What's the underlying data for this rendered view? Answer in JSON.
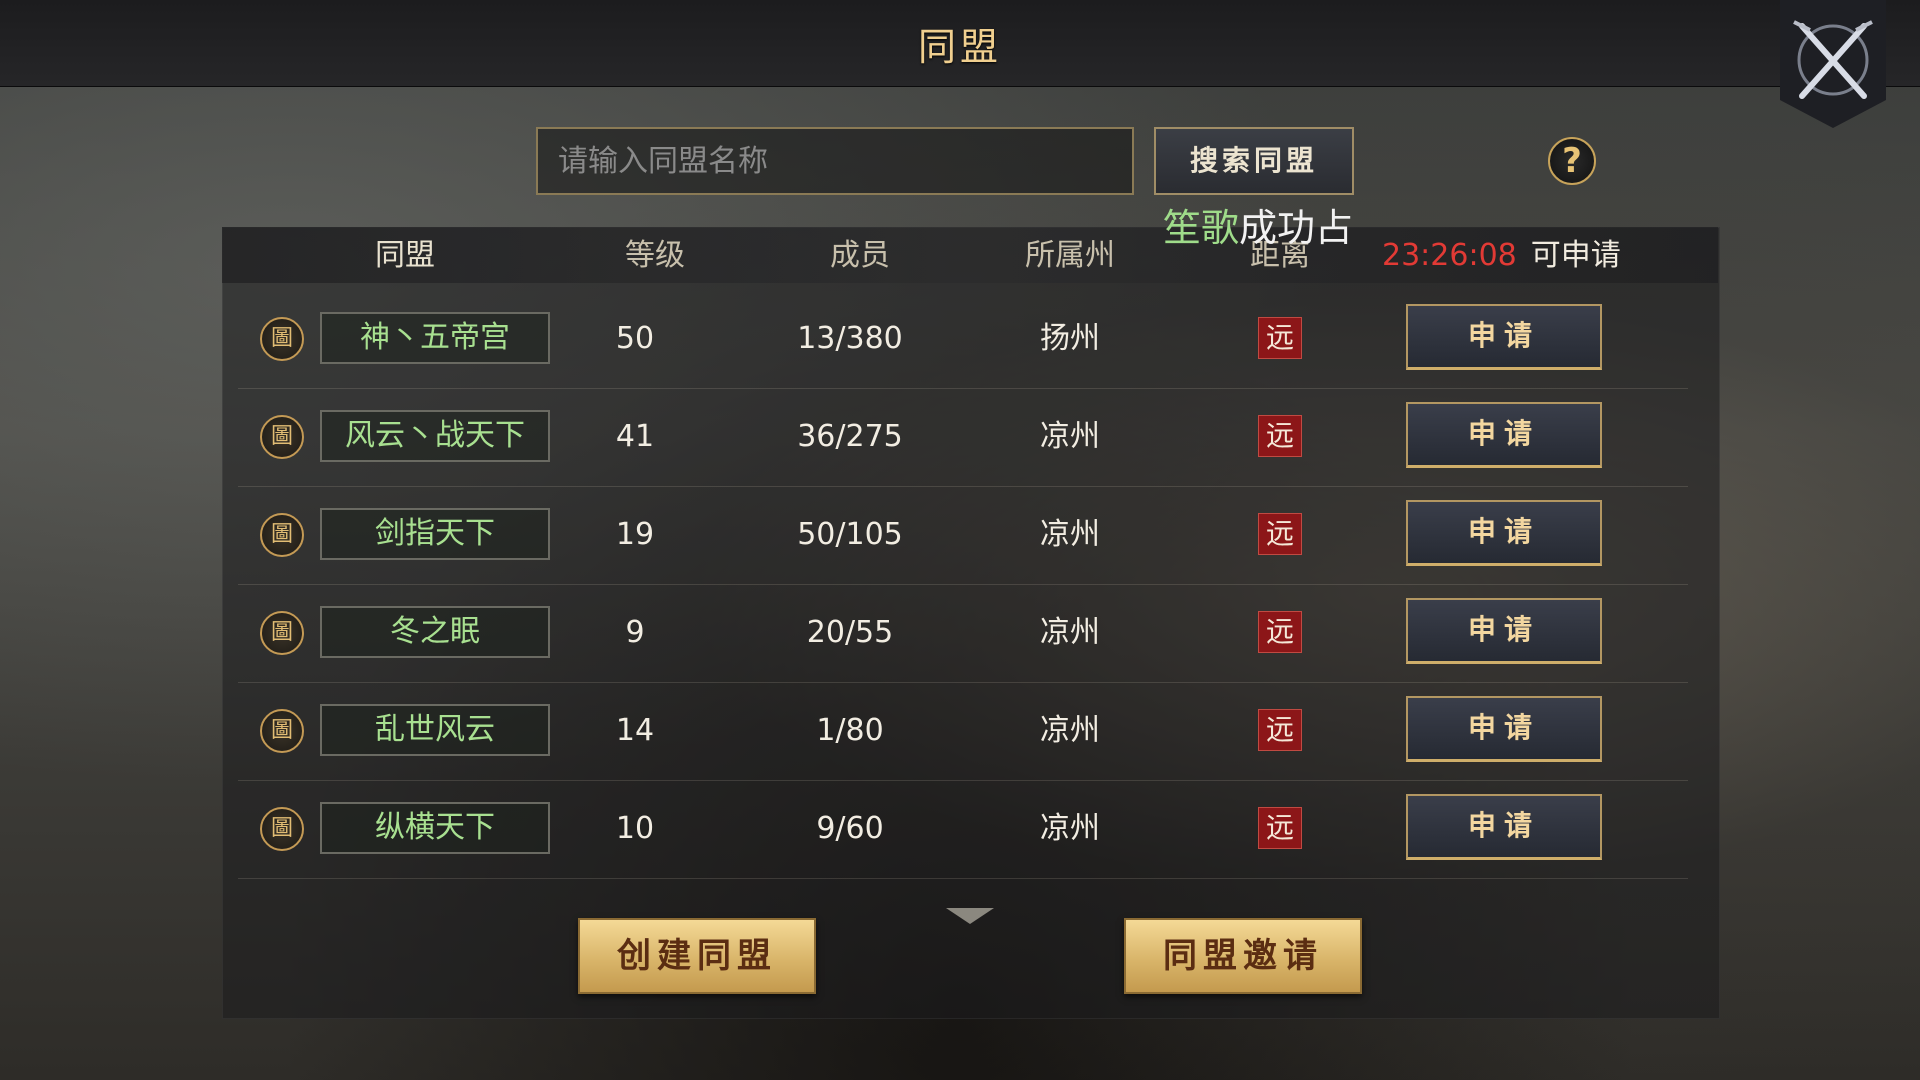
{
  "header": {
    "title": "同盟"
  },
  "search": {
    "placeholder": "请输入同盟名称",
    "button_label": "搜索同盟"
  },
  "help": {
    "label": "?"
  },
  "notice": {
    "highlight": "笙歌",
    "text": "成功占"
  },
  "table": {
    "columns": [
      "同盟",
      "等级",
      "成员",
      "所属州",
      "距离"
    ],
    "cooldown_time": "23:26:08",
    "cooldown_label": "可申请",
    "apply_label": "申请",
    "emblem_glyph": "圖",
    "rows": [
      {
        "name": "神丶五帝宫",
        "level": "50",
        "members": "13/380",
        "state": "扬州",
        "distance": "远"
      },
      {
        "name": "风云丶战天下",
        "level": "41",
        "members": "36/275",
        "state": "凉州",
        "distance": "远"
      },
      {
        "name": "剑指天下",
        "level": "19",
        "members": "50/105",
        "state": "凉州",
        "distance": "远"
      },
      {
        "name": "冬之眠",
        "level": "9",
        "members": "20/55",
        "state": "凉州",
        "distance": "远"
      },
      {
        "name": "乱世风云",
        "level": "14",
        "members": "1/80",
        "state": "凉州",
        "distance": "远"
      },
      {
        "name": "纵横天下",
        "level": "10",
        "members": "9/60",
        "state": "凉州",
        "distance": "远"
      }
    ]
  },
  "footer": {
    "create_label": "创建同盟",
    "invite_label": "同盟邀请"
  },
  "icons": {
    "close": "crossed-swords-icon",
    "more": "chevron-down-icon",
    "emblem": "alliance-emblem-icon"
  },
  "colors": {
    "accent_gold": "#f0cf8f",
    "name_green": "#a8e090",
    "timer_red": "#e23a35",
    "distance_red": "#8c1618"
  }
}
